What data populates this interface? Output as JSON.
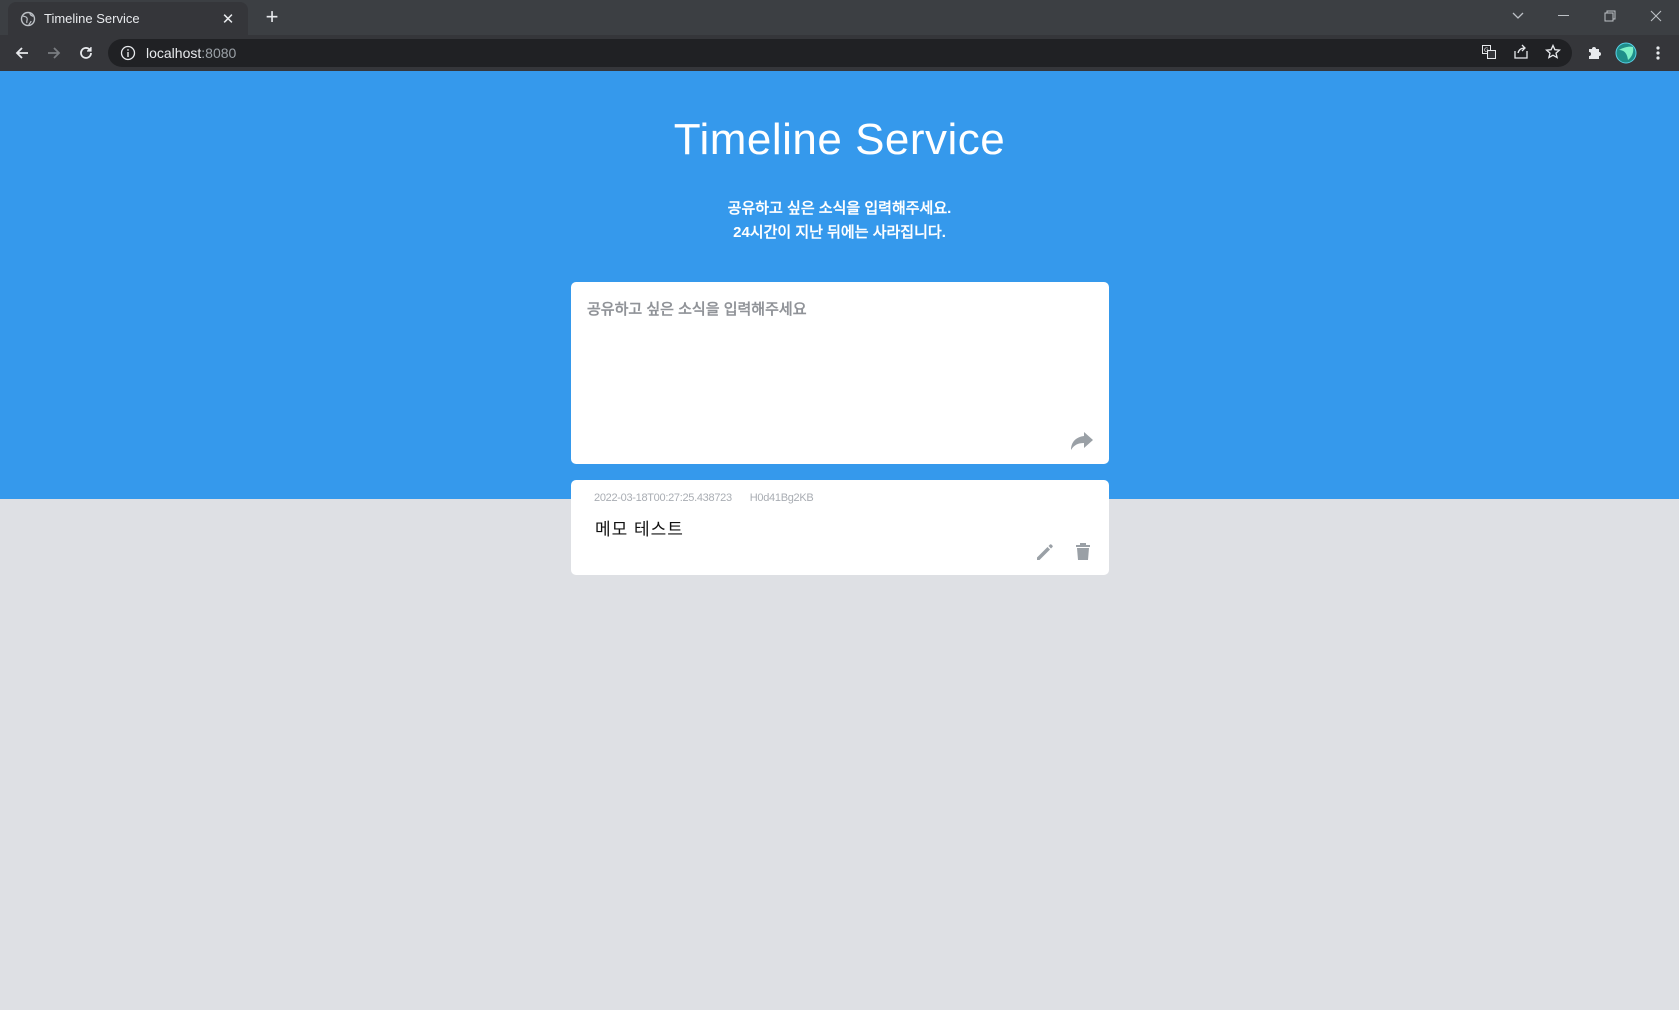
{
  "browser": {
    "tab_title": "Timeline Service",
    "url_host": "localhost",
    "url_port": ":8080"
  },
  "hero": {
    "title": "Timeline Service",
    "subtitle_line1": "공유하고 싶은 소식을 입력해주세요.",
    "subtitle_line2": "24시간이 지난 뒤에는 사라집니다."
  },
  "composer": {
    "placeholder": "공유하고 싶은 소식을 입력해주세요",
    "value": ""
  },
  "posts": [
    {
      "timestamp": "2022-03-18T00:27:25.438723",
      "user_id": "H0d41Bg2KB",
      "content": "메모 테스트"
    }
  ],
  "colors": {
    "hero_bg": "#3599ec",
    "page_bg": "#dee0e4",
    "card_bg": "#ffffff",
    "icon_gray": "#9aa0a6"
  }
}
